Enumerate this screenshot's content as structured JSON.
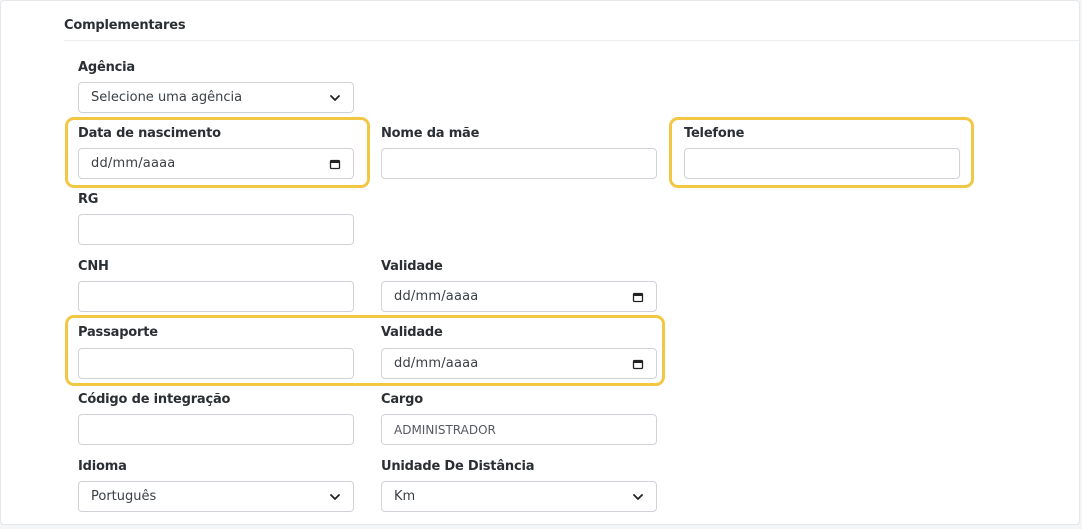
{
  "section": {
    "title": "Complementares"
  },
  "agencia": {
    "label": "Agência",
    "selected": "Selecione uma agência"
  },
  "data_nascimento": {
    "label": "Data de nascimento",
    "value": "dd/mm/aaaa"
  },
  "nome_mae": {
    "label": "Nome da mãe",
    "value": ""
  },
  "telefone": {
    "label": "Telefone",
    "value": ""
  },
  "rg": {
    "label": "RG",
    "value": ""
  },
  "cnh": {
    "label": "CNH",
    "value": ""
  },
  "cnh_validade": {
    "label": "Validade",
    "value": "dd/mm/aaaa"
  },
  "passaporte": {
    "label": "Passaporte",
    "value": ""
  },
  "passaporte_validade": {
    "label": "Validade",
    "value": "dd/mm/aaaa"
  },
  "codigo_integracao": {
    "label": "Código de integração",
    "value": ""
  },
  "cargo": {
    "label": "Cargo",
    "value": "ADMINISTRADOR"
  },
  "idioma": {
    "label": "Idioma",
    "selected": "Português"
  },
  "unidade_distancia": {
    "label": "Unidade De Distância",
    "selected": "Km"
  },
  "highlight_color": "#f2c744"
}
